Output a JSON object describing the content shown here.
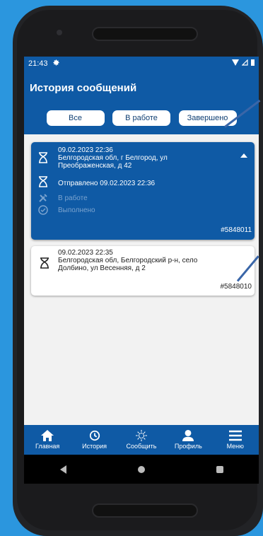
{
  "status_bar": {
    "time": "21:43"
  },
  "header": {
    "title": "История сообщений"
  },
  "filters": [
    {
      "label": "Все"
    },
    {
      "label": "В работе"
    },
    {
      "label": "Завершено"
    }
  ],
  "messages": [
    {
      "datetime": "09.02.2023 22:36",
      "address_line1": "Белгородская обл, г Белгород, ул",
      "address_line2": "Преображенская, д 42",
      "sent": "Отправлено 09.02.2023 22:36",
      "in_work": "В работе",
      "done": "Выполнено",
      "number": "#5848011"
    },
    {
      "datetime": "09.02.2023 22:35",
      "address_line1": "Белгородская обл, Белгородский р-н, село",
      "address_line2": "Долбино, ул Весенняя, д 2",
      "number": "#5848010"
    }
  ],
  "bottom_nav": [
    {
      "label": "Главная"
    },
    {
      "label": "История"
    },
    {
      "label": "Сообщить"
    },
    {
      "label": "Профиль"
    },
    {
      "label": "Меню"
    }
  ],
  "colors": {
    "primary": "#0f5aa5",
    "background": "#2b96de"
  }
}
